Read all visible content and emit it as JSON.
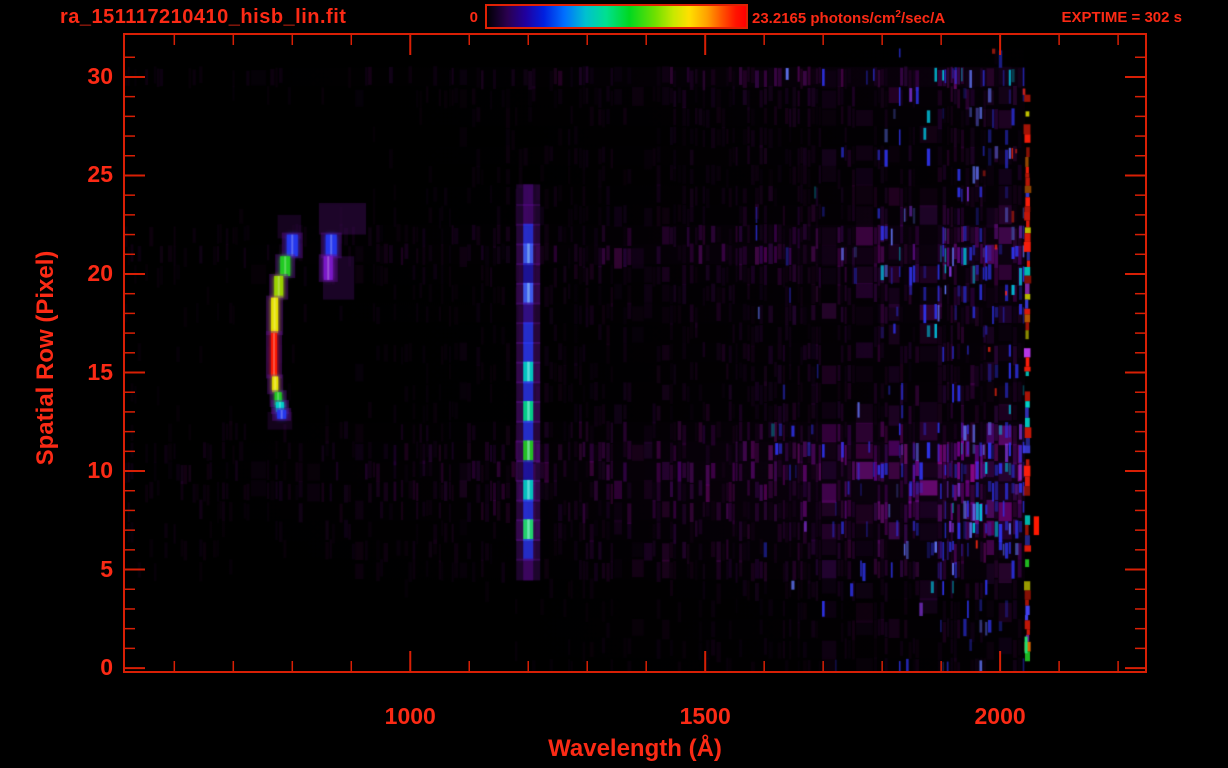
{
  "header": {
    "title": "ra_151117210410_hisb_lin.fit",
    "colorbar": {
      "min_label": "0",
      "max_label_prefix": "23.2165 photons/cm",
      "max_label_sup": "2",
      "max_label_suffix": "/sec/A"
    },
    "exptime_label": "EXPTIME = 302 s"
  },
  "colors": {
    "background": "#000000",
    "text_red": "#fb2a15",
    "axis_red": "#d81f05"
  },
  "chart_data": {
    "type": "heatmap",
    "title": "ra_151117210410_hisb_lin.fit",
    "xlabel": "Wavelength (Å)",
    "ylabel": "Spatial Row (Pixel)",
    "colorbar": {
      "min": 0,
      "max": 23.2165,
      "units": "photons/cm2/sec/A"
    },
    "exposure_time_s": 302,
    "axes": {
      "x": {
        "min": 513,
        "max": 2249,
        "major_ticks": [
          1000,
          1500,
          2000
        ],
        "minor_tick_start": 600,
        "minor_tick_end": 2200,
        "minor_tick_step": 100
      },
      "y": {
        "min": -0.25,
        "max": 32.23,
        "major_ticks": [
          0,
          5,
          10,
          15,
          20,
          25,
          30
        ],
        "minor_tick_start": 0,
        "minor_tick_end": 31,
        "minor_tick_step": 1
      }
    },
    "features": {
      "emission_arc": {
        "description": "bright curved emission feature near 770-800 A, rows 13-22, red-hot core rows 15-17",
        "segments": [
          {
            "lambda": 800,
            "row0": 20.9,
            "row1": 22.0,
            "color": "blue",
            "w": 11
          },
          {
            "lambda": 788,
            "row0": 19.9,
            "row1": 20.9,
            "color": "green",
            "w": 10
          },
          {
            "lambda": 777,
            "row0": 18.8,
            "row1": 19.9,
            "color": "yellowGreen",
            "w": 9
          },
          {
            "lambda": 770,
            "row0": 17.0,
            "row1": 18.8,
            "color": "yellow",
            "w": 7
          },
          {
            "lambda": 769,
            "row0": 14.8,
            "row1": 17.0,
            "color": "red",
            "w": 6
          },
          {
            "lambda": 771,
            "row0": 14.0,
            "row1": 14.8,
            "color": "yellow",
            "w": 6
          },
          {
            "lambda": 776,
            "row0": 13.35,
            "row1": 14.0,
            "color": "green",
            "w": 7
          },
          {
            "lambda": 779,
            "row0": 13.0,
            "row1": 13.5,
            "color": "cyan",
            "w": 8
          },
          {
            "lambda": 782,
            "row0": 12.65,
            "row1": 13.1,
            "color": "blue",
            "w": 9
          }
        ]
      },
      "secondary_arc": {
        "description": "fainter companion arc near 860-870 A, rows 20-22",
        "segments": [
          {
            "lambda": 866,
            "row0": 20.9,
            "row1": 22.0,
            "color": "blue",
            "w": 11
          },
          {
            "lambda": 861,
            "row0": 19.7,
            "row1": 20.9,
            "color": "purpleBright",
            "w": 9
          }
        ]
      },
      "haze_patches": [
        {
          "l0": 845,
          "l1": 925,
          "r0": 22.0,
          "r1": 23.6,
          "a": 0.3
        },
        {
          "l0": 775,
          "l1": 815,
          "r0": 21.8,
          "r1": 23.0,
          "a": 0.22
        },
        {
          "l0": 852,
          "l1": 905,
          "r0": 18.7,
          "r1": 20.9,
          "a": 0.28
        },
        {
          "l0": 758,
          "l1": 800,
          "r0": 12.1,
          "r1": 13.0,
          "a": 0.2
        }
      ],
      "lyman_alpha_line": {
        "description": "bright vertical emission line near 1200 A spanning rows 5-24",
        "lambda": 1200,
        "width_A": 17,
        "segments": [
          {
            "row": 24,
            "color": "purple",
            "b": 0.25
          },
          {
            "row": 23,
            "color": "purple",
            "b": 0.3
          },
          {
            "row": 22,
            "color": "blue",
            "b": 0.55
          },
          {
            "row": 21,
            "color": "blueBright",
            "b": 0.8
          },
          {
            "row": 20,
            "color": "blueDark",
            "b": 0.45
          },
          {
            "row": 19,
            "color": "blueBright",
            "b": 0.85
          },
          {
            "row": 18,
            "color": "purpleBlue",
            "b": 0.35
          },
          {
            "row": 17,
            "color": "blue",
            "b": 0.6
          },
          {
            "row": 16,
            "color": "blue",
            "b": 0.7
          },
          {
            "row": 15,
            "color": "cyan",
            "b": 0.95
          },
          {
            "row": 14,
            "color": "blue",
            "b": 0.6
          },
          {
            "row": 13,
            "color": "cyanGreen",
            "b": 0.95
          },
          {
            "row": 12,
            "color": "blue",
            "b": 0.6
          },
          {
            "row": 11,
            "color": "green",
            "b": 0.95
          },
          {
            "row": 10,
            "color": "blueDark",
            "b": 0.5
          },
          {
            "row": 9,
            "color": "cyan",
            "b": 0.9
          },
          {
            "row": 8,
            "color": "blue",
            "b": 0.6
          },
          {
            "row": 7,
            "color": "greenCyan",
            "b": 0.95
          },
          {
            "row": 6,
            "color": "blue",
            "b": 0.55
          },
          {
            "row": 5,
            "color": "purple",
            "b": 0.3
          }
        ]
      },
      "detector_edge": {
        "description": "bright speckled cutoff column near 2045 A, rows 1-29",
        "l0": 2042,
        "l1": 2049,
        "row0": 0.7,
        "row1": 29.1
      },
      "edge_green_tip": {
        "lambda": 2044,
        "row0": 0.75,
        "row1": 1.6
      },
      "red_blob": {
        "l0": 2057,
        "l1": 2066,
        "row0": 6.75,
        "row1": 7.7
      },
      "blue_noise_region": {
        "lambda_start": 1580,
        "lambda_end": 2042
      }
    },
    "noise": {
      "seed": 1234567,
      "row_intensity": [
        0.05,
        0.06,
        0.07,
        0.06,
        0.08,
        0.14,
        0.18,
        0.22,
        0.3,
        0.33,
        0.38,
        0.33,
        0.22,
        0.12,
        0.12,
        0.1,
        0.12,
        0.1,
        0.14,
        0.12,
        0.16,
        0.3,
        0.22,
        0.12,
        0.1,
        0.08,
        0.1,
        0.08,
        0.1,
        0.12,
        0.25,
        0.02
      ],
      "blue_row": [
        0.15,
        0.15,
        0.15,
        0.2,
        0.2,
        0.5,
        0.9,
        0.95,
        0.9,
        1.0,
        0.95,
        0.9,
        0.6,
        0.35,
        0.3,
        0.3,
        0.35,
        0.3,
        0.5,
        0.55,
        0.6,
        0.7,
        0.55,
        0.45,
        0.3,
        0.25,
        0.3,
        0.25,
        0.3,
        0.35,
        0.5,
        0.05
      ]
    }
  }
}
